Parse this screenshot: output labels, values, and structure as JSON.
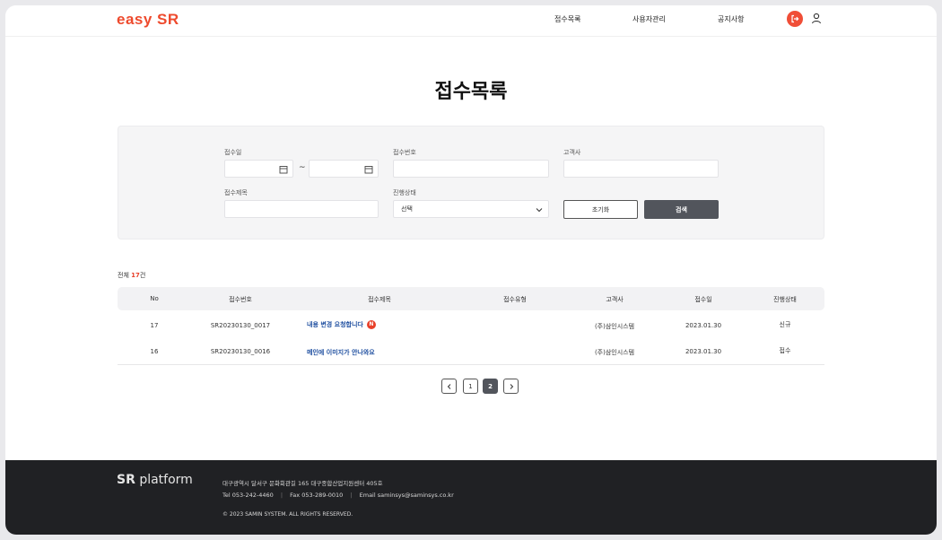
{
  "header": {
    "logo": "easy SR",
    "nav": [
      "접수목록",
      "사용자관리",
      "공지사항"
    ]
  },
  "page": {
    "title": "접수목록"
  },
  "search": {
    "received_date_label": "접수일",
    "range_sep": "~",
    "receipt_no_label": "접수번호",
    "customer_label": "고객사",
    "subject_label": "접수제목",
    "status_label": "진행상태",
    "status_value": "선택",
    "reset_label": "초기화",
    "search_label": "검색"
  },
  "total": {
    "prefix": "전체 ",
    "count": "17",
    "suffix": "건"
  },
  "table": {
    "headers": [
      "No",
      "접수번호",
      "접수제목",
      "접수유형",
      "고객사",
      "접수일",
      "진행상태"
    ],
    "rows": [
      {
        "no": "17",
        "receipt_no": "SR20230130_0017",
        "title": "내용 변경 요청합니다",
        "badge": "N",
        "type": "",
        "customer": "(주)삼인시스템",
        "date": "2023.01.30",
        "status": "신규"
      },
      {
        "no": "16",
        "receipt_no": "SR20230130_0016",
        "title": "메인에 이미지가 안나와요",
        "badge": "",
        "type": "",
        "customer": "(주)삼인시스템",
        "date": "2023.01.30",
        "status": "접수"
      }
    ]
  },
  "pagination": {
    "prev": "<",
    "pages": [
      "1",
      "2"
    ],
    "current": "2",
    "next": ">"
  },
  "footer": {
    "logo_bold": "SR",
    "logo_rest": " platform",
    "address": "대구광역시 달서구 문화회관길 165 대구종합산업지원센터 405호",
    "tel_label": "Tel",
    "tel": "053-242-4460",
    "fax_label": "Fax",
    "fax": "053-289-0010",
    "email_label": "Email",
    "email": "saminsys@saminsys.co.kr",
    "copyright": "© 2023 SAMIN SYSTEM. ALL RIGHTS RESERVED."
  },
  "colors": {
    "accent": "#ee4a2d",
    "dark_button": "#52555c",
    "link": "#1f4fa0",
    "footer_bg": "#202124"
  }
}
